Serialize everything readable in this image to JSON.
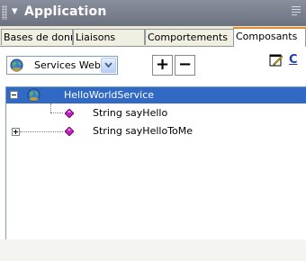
{
  "panel": {
    "title": "Application",
    "title_arrow": "▾",
    "options_icon": "panel-options-icon"
  },
  "tabs": [
    {
      "label": "Bases de donné",
      "active": false
    },
    {
      "label": "Liaisons",
      "active": false
    },
    {
      "label": "Comportements",
      "active": false
    },
    {
      "label": "Composants",
      "active": true
    }
  ],
  "toolbar": {
    "component_type": "Services Web",
    "add_label": "+",
    "remove_label": "−",
    "edit_icon": "edit-icon",
    "refresh_icon_text": "C"
  },
  "tree": {
    "root": {
      "label": "HelloWorldService",
      "expanded": true,
      "selected": true
    },
    "children": [
      {
        "label": "String sayHello",
        "has_children": false
      },
      {
        "label": "String sayHelloToMe",
        "has_children": true
      }
    ]
  },
  "colors": {
    "title_bar": "#7a7f8e",
    "selection": "#316ac5",
    "active_tab_accent": "#e68b2c",
    "method_icon": "#c020c0"
  }
}
